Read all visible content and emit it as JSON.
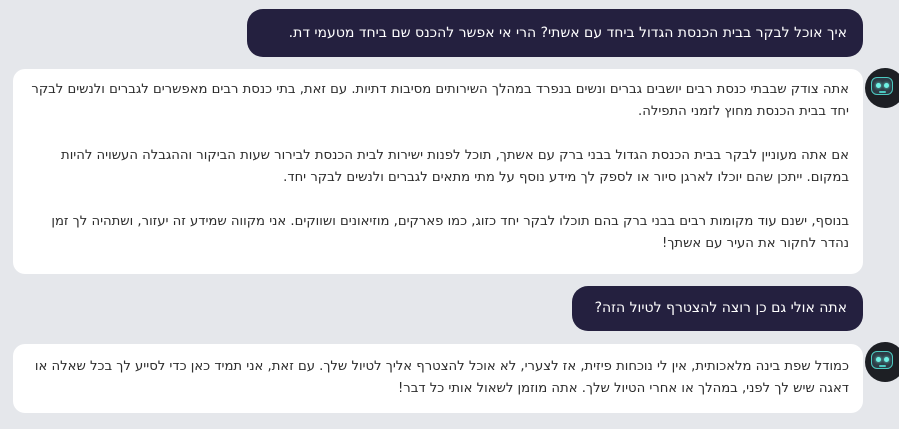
{
  "conversation": {
    "messages": [
      {
        "role": "user",
        "text": "איך אוכל לבקר בבית הכנסת הגדול ביחד עם אשתי? הרי אי אפשר להכנס שם ביחד מטעמי דת."
      },
      {
        "role": "assistant",
        "avatar_icon": "robot-avatar-icon",
        "paragraphs": [
          "אתה צודק שבבתי כנסת רבים יושבים גברים ונשים בנפרד במהלך השירותים מסיבות דתיות. עם זאת, בתי כנסת רבים מאפשרים לגברים ולנשים לבקר יחד בבית הכנסת מחוץ לזמני התפילה.",
          "אם אתה מעוניין לבקר בבית הכנסת הגדול בבני ברק עם אשתך, תוכל לפנות ישירות לבית הכנסת לבירור שעות הביקור וההגבלה העשויה להיות במקום. ייתכן שהם יוכלו לארגן סיור או לספק לך מידע נוסף על מתי מתאים לגברים ולנשים לבקר יחד.",
          "בנוסף, ישנם עוד מקומות רבים בבני ברק בהם תוכלו לבקר יחד כזוג, כמו פארקים, מוזיאונים ושווקים. אני מקווה שמידע זה יעזור, ושתהיה לך זמן נהדר לחקור את העיר עם אשתך!"
        ]
      },
      {
        "role": "user",
        "text": "אתה אולי גם כן רוצה להצטרף לטיול הזה?"
      },
      {
        "role": "assistant",
        "avatar_icon": "robot-avatar-icon",
        "paragraphs": [
          "כמודל שפת בינה מלאכותית, אין לי נוכחות פיזית, אז לצערי, לא אוכל להצטרף אליך לטיול שלך. עם זאת, אני תמיד כאן כדי לסייע לך בכל שאלה או דאגה שיש לך לפני, במהלך או אחרי הטיול שלך. אתה מוזמן לשאול אותי כל דבר!"
        ]
      }
    ]
  },
  "colors": {
    "background": "#e5e7eb",
    "user_bubble": "#24203f",
    "assistant_bubble": "#ffffff",
    "avatar_accent": "#6ff2e5"
  }
}
